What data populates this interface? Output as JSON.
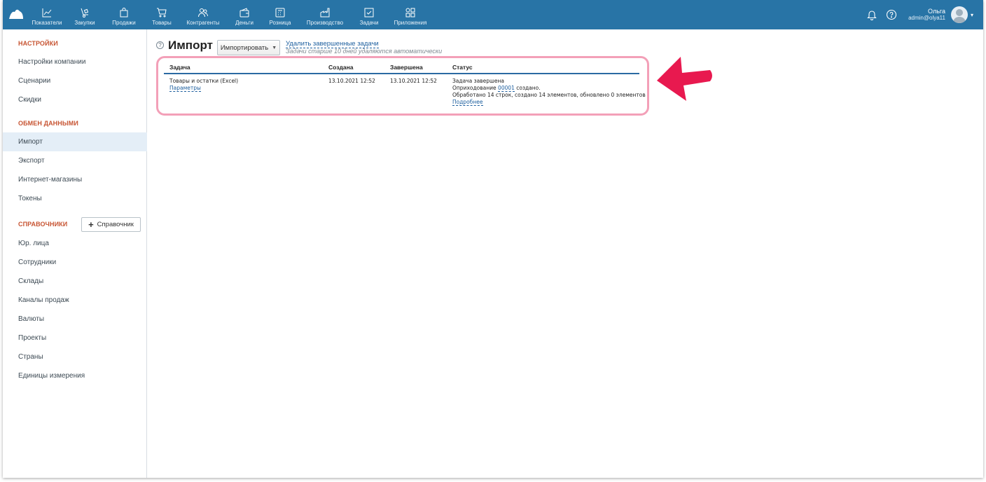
{
  "topbar": {
    "nav": [
      {
        "label": "Показатели",
        "icon": "chart-line-icon"
      },
      {
        "label": "Закупки",
        "icon": "dolly-icon"
      },
      {
        "label": "Продажи",
        "icon": "shopping-bag-icon"
      },
      {
        "label": "Товары",
        "icon": "cart-icon"
      },
      {
        "label": "Контрагенты",
        "icon": "people-icon"
      },
      {
        "label": "Деньги",
        "icon": "wallet-icon"
      },
      {
        "label": "Розница",
        "icon": "cash-register-icon"
      },
      {
        "label": "Производство",
        "icon": "factory-icon"
      },
      {
        "label": "Задачи",
        "icon": "task-check-icon"
      },
      {
        "label": "Приложения",
        "icon": "apps-grid-icon"
      }
    ],
    "user_name": "Ольга",
    "user_email": "admin@olya11",
    "brand_color": "#2874a6"
  },
  "sidebar": {
    "section_settings": "НАСТРОЙКИ",
    "settings_items": [
      "Настройки компании",
      "Сценарии",
      "Скидки"
    ],
    "section_exchange": "ОБМЕН ДАННЫМИ",
    "exchange_items": [
      "Импорт",
      "Экспорт",
      "Интернет-магазины",
      "Токены"
    ],
    "section_refs": "СПРАВОЧНИКИ",
    "add_ref_label": "Справочник",
    "ref_items": [
      "Юр. лица",
      "Сотрудники",
      "Склады",
      "Каналы продаж",
      "Валюты",
      "Проекты",
      "Страны",
      "Единицы измерения"
    ],
    "active_item": "Импорт",
    "section_color": "#c75432"
  },
  "main": {
    "help": "?",
    "title": "Импорт",
    "import_button": "Импортировать",
    "delete_link": "Удалить завершенные задачи",
    "delete_note": "Задачи старше 10 дней удаляются автоматически",
    "table": {
      "headers": {
        "task": "Задача",
        "created": "Создана",
        "finished": "Завершена",
        "status": "Статус"
      },
      "row": {
        "task": "Товары и остатки (Excel)",
        "params_link": "Параметры",
        "created": "13.10.2021 12:52",
        "finished": "13.10.2021 12:52",
        "status_line1": "Задача завершена",
        "status_line2_pre": "Оприходование ",
        "status_line2_link": "00001",
        "status_line2_post": " создано.",
        "status_line3": "Обработано 14 строк, создано 14 элементов, обновлено 0 элементов",
        "details_link": "Подробнее"
      }
    },
    "highlight_color": "#f3a0b8",
    "arrow_color": "#e8194f"
  }
}
